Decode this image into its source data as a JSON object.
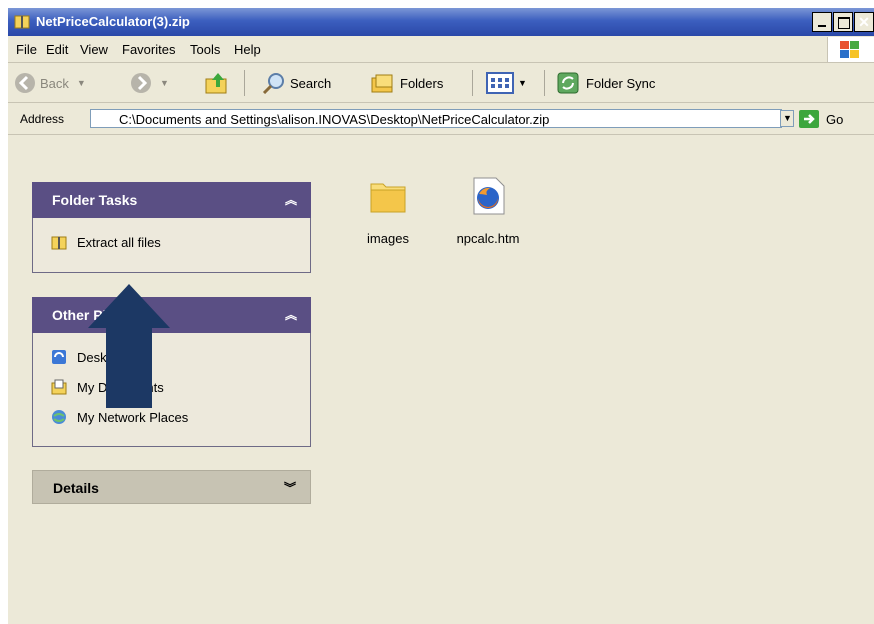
{
  "window": {
    "title": "NetPriceCalculator(3).zip"
  },
  "menu": [
    "File",
    "Edit",
    "View",
    "Favorites",
    "Tools",
    "Help"
  ],
  "toolbar": {
    "back": "Back",
    "search": "Search",
    "folders": "Folders",
    "folder_sync": "Folder Sync"
  },
  "address": {
    "label": "Address",
    "value": "C:\\Documents and Settings\\alison.INOVAS\\Desktop\\NetPriceCalculator.zip",
    "go": "Go"
  },
  "folder_tasks": {
    "title": "Folder Tasks",
    "items": [
      {
        "label": "Extract all files",
        "icon": "zip-folder-icon"
      }
    ]
  },
  "other_places": {
    "title": "Other Places",
    "items": [
      {
        "label": "Desktop",
        "icon": "desktop-icon"
      },
      {
        "label": "My Documents",
        "icon": "my-documents-icon"
      },
      {
        "label": "My Network Places",
        "icon": "network-places-icon"
      }
    ]
  },
  "details": {
    "title": "Details"
  },
  "files": [
    {
      "name": "images",
      "icon": "folder-icon"
    },
    {
      "name": "npcalc.htm",
      "icon": "firefox-html-icon"
    }
  ],
  "colors": {
    "accent": "#5a4f84",
    "arrow": "#1c3864",
    "titlebar": "#3c5fbf"
  }
}
